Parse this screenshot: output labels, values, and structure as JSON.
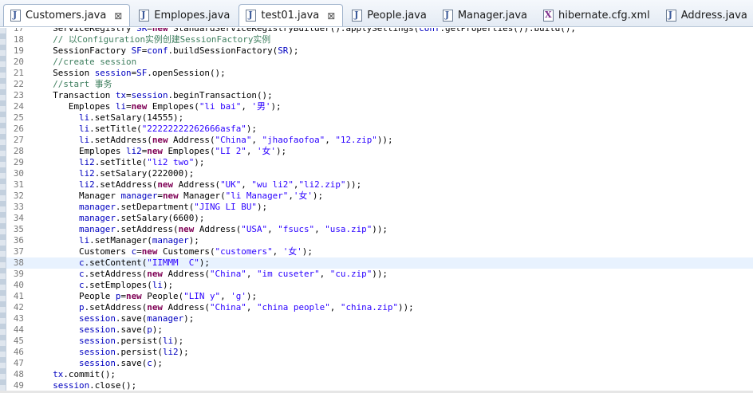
{
  "tabs": [
    {
      "label": "Customers.java",
      "icon": "java-file-icon",
      "close": "⊠",
      "state": "active"
    },
    {
      "label": "Emplopes.java",
      "icon": "java-file-icon",
      "close": "",
      "state": "normal"
    },
    {
      "label": "test01.java",
      "icon": "java-file-icon",
      "close": "⊠",
      "state": "selected"
    },
    {
      "label": "People.java",
      "icon": "java-file-icon",
      "close": "",
      "state": "normal"
    },
    {
      "label": "Manager.java",
      "icon": "java-file-icon",
      "close": "",
      "state": "normal"
    },
    {
      "label": "hibernate.cfg.xml",
      "icon": "xml-file-icon",
      "close": "",
      "state": "normal"
    },
    {
      "label": "Address.java",
      "icon": "java-file-icon",
      "close": "",
      "state": "normal"
    }
  ],
  "editor": {
    "current_line": "38",
    "lines": [
      {
        "n": "17",
        "indent": "    ",
        "tokens": [
          [
            "ServiceRegistry ",
            "p"
          ],
          [
            "SR",
            "v"
          ],
          [
            "=",
            "p"
          ],
          [
            "new",
            "k"
          ],
          [
            " StandardServiceRegistryBuilder().applySettings(",
            "p"
          ],
          [
            "conf",
            "v"
          ],
          [
            ".getProperties()).build();",
            "p"
          ]
        ]
      },
      {
        "n": "18",
        "indent": "    ",
        "tokens": [
          [
            "// 以Configuration实例创建SessionFactory实例",
            "c"
          ]
        ]
      },
      {
        "n": "19",
        "indent": "    ",
        "tokens": [
          [
            "SessionFactory ",
            "p"
          ],
          [
            "SF",
            "v"
          ],
          [
            "=",
            "p"
          ],
          [
            "conf",
            "v"
          ],
          [
            ".buildSessionFactory(",
            "p"
          ],
          [
            "SR",
            "v"
          ],
          [
            ");",
            "p"
          ]
        ]
      },
      {
        "n": "20",
        "indent": "    ",
        "tokens": [
          [
            "//create session",
            "c"
          ]
        ]
      },
      {
        "n": "21",
        "indent": "    ",
        "tokens": [
          [
            "Session ",
            "p"
          ],
          [
            "session",
            "v"
          ],
          [
            "=",
            "p"
          ],
          [
            "SF",
            "v"
          ],
          [
            ".openSession();",
            "p"
          ]
        ]
      },
      {
        "n": "22",
        "indent": "    ",
        "tokens": [
          [
            "//start 事务",
            "c"
          ]
        ]
      },
      {
        "n": "23",
        "indent": "    ",
        "tokens": [
          [
            "Transaction ",
            "p"
          ],
          [
            "tx",
            "v"
          ],
          [
            "=",
            "p"
          ],
          [
            "session",
            "v"
          ],
          [
            ".beginTransaction();",
            "p"
          ]
        ]
      },
      {
        "n": "24",
        "indent": "       ",
        "tokens": [
          [
            "Emplopes ",
            "p"
          ],
          [
            "li",
            "v"
          ],
          [
            "=",
            "p"
          ],
          [
            "new",
            "k"
          ],
          [
            " Emplopes(",
            "p"
          ],
          [
            "\"li bai\"",
            "s"
          ],
          [
            ", ",
            "p"
          ],
          [
            "'男'",
            "s"
          ],
          [
            ");",
            "p"
          ]
        ]
      },
      {
        "n": "25",
        "indent": "         ",
        "tokens": [
          [
            "li",
            "v"
          ],
          [
            ".setSalary(14555);",
            "p"
          ]
        ]
      },
      {
        "n": "26",
        "indent": "         ",
        "tokens": [
          [
            "li",
            "v"
          ],
          [
            ".setTitle(",
            "p"
          ],
          [
            "\"22222222262666asfa\"",
            "s"
          ],
          [
            ");",
            "p"
          ]
        ]
      },
      {
        "n": "27",
        "indent": "         ",
        "tokens": [
          [
            "li",
            "v"
          ],
          [
            ".setAddress(",
            "p"
          ],
          [
            "new",
            "k"
          ],
          [
            " Address(",
            "p"
          ],
          [
            "\"China\"",
            "s"
          ],
          [
            ", ",
            "p"
          ],
          [
            "\"jhaofaofoa\"",
            "s"
          ],
          [
            ", ",
            "p"
          ],
          [
            "\"12.zip\"",
            "s"
          ],
          [
            "));",
            "p"
          ]
        ]
      },
      {
        "n": "28",
        "indent": "         ",
        "tokens": [
          [
            "Emplopes ",
            "p"
          ],
          [
            "li2",
            "v"
          ],
          [
            "=",
            "p"
          ],
          [
            "new",
            "k"
          ],
          [
            " Emplopes(",
            "p"
          ],
          [
            "\"LI 2\"",
            "s"
          ],
          [
            ", ",
            "p"
          ],
          [
            "'女'",
            "s"
          ],
          [
            ");",
            "p"
          ]
        ]
      },
      {
        "n": "29",
        "indent": "         ",
        "tokens": [
          [
            "li2",
            "v"
          ],
          [
            ".setTitle(",
            "p"
          ],
          [
            "\"li2 two\"",
            "s"
          ],
          [
            ");",
            "p"
          ]
        ]
      },
      {
        "n": "30",
        "indent": "         ",
        "tokens": [
          [
            "li2",
            "v"
          ],
          [
            ".setSalary(222000);",
            "p"
          ]
        ]
      },
      {
        "n": "31",
        "indent": "         ",
        "tokens": [
          [
            "li2",
            "v"
          ],
          [
            ".setAddress(",
            "p"
          ],
          [
            "new",
            "k"
          ],
          [
            " Address(",
            "p"
          ],
          [
            "\"UK\"",
            "s"
          ],
          [
            ", ",
            "p"
          ],
          [
            "\"wu li2\"",
            "s"
          ],
          [
            ",",
            "p"
          ],
          [
            "\"li2.zip\"",
            "s"
          ],
          [
            "));",
            "p"
          ]
        ]
      },
      {
        "n": "32",
        "indent": "         ",
        "tokens": [
          [
            "Manager ",
            "p"
          ],
          [
            "manager",
            "v"
          ],
          [
            "=",
            "p"
          ],
          [
            "new",
            "k"
          ],
          [
            " Manager(",
            "p"
          ],
          [
            "\"li Manager\"",
            "s"
          ],
          [
            ",",
            "p"
          ],
          [
            "'女'",
            "s"
          ],
          [
            ");",
            "p"
          ]
        ]
      },
      {
        "n": "33",
        "indent": "         ",
        "tokens": [
          [
            "manager",
            "v"
          ],
          [
            ".setDepartment(",
            "p"
          ],
          [
            "\"JING LI BU\"",
            "s"
          ],
          [
            ");",
            "p"
          ]
        ]
      },
      {
        "n": "34",
        "indent": "         ",
        "tokens": [
          [
            "manager",
            "v"
          ],
          [
            ".setSalary(6600);",
            "p"
          ]
        ]
      },
      {
        "n": "35",
        "indent": "         ",
        "tokens": [
          [
            "manager",
            "v"
          ],
          [
            ".setAddress(",
            "p"
          ],
          [
            "new",
            "k"
          ],
          [
            " Address(",
            "p"
          ],
          [
            "\"USA\"",
            "s"
          ],
          [
            ", ",
            "p"
          ],
          [
            "\"fsucs\"",
            "s"
          ],
          [
            ", ",
            "p"
          ],
          [
            "\"usa.zip\"",
            "s"
          ],
          [
            "));",
            "p"
          ]
        ]
      },
      {
        "n": "36",
        "indent": "         ",
        "tokens": [
          [
            "li",
            "v"
          ],
          [
            ".setManager(",
            "p"
          ],
          [
            "manager",
            "v"
          ],
          [
            ");",
            "p"
          ]
        ]
      },
      {
        "n": "37",
        "indent": "         ",
        "tokens": [
          [
            "Customers ",
            "p"
          ],
          [
            "c",
            "v"
          ],
          [
            "=",
            "p"
          ],
          [
            "new",
            "k"
          ],
          [
            " Customers(",
            "p"
          ],
          [
            "\"customers\"",
            "s"
          ],
          [
            ", ",
            "p"
          ],
          [
            "'女'",
            "s"
          ],
          [
            ");",
            "p"
          ]
        ]
      },
      {
        "n": "38",
        "indent": "         ",
        "tokens": [
          [
            "c",
            "v"
          ],
          [
            ".setContent(",
            "p"
          ],
          [
            "\"IIMMM  C\"",
            "s"
          ],
          [
            ");",
            "p"
          ]
        ]
      },
      {
        "n": "39",
        "indent": "         ",
        "tokens": [
          [
            "c",
            "v"
          ],
          [
            ".setAddress(",
            "p"
          ],
          [
            "new",
            "k"
          ],
          [
            " Address(",
            "p"
          ],
          [
            "\"China\"",
            "s"
          ],
          [
            ", ",
            "p"
          ],
          [
            "\"im cuseter\"",
            "s"
          ],
          [
            ", ",
            "p"
          ],
          [
            "\"cu.zip\"",
            "s"
          ],
          [
            "));",
            "p"
          ]
        ]
      },
      {
        "n": "40",
        "indent": "         ",
        "tokens": [
          [
            "c",
            "v"
          ],
          [
            ".setEmplopes(",
            "p"
          ],
          [
            "li",
            "v"
          ],
          [
            ");",
            "p"
          ]
        ]
      },
      {
        "n": "41",
        "indent": "         ",
        "tokens": [
          [
            "People ",
            "p"
          ],
          [
            "p",
            "v"
          ],
          [
            "=",
            "p"
          ],
          [
            "new",
            "k"
          ],
          [
            " People(",
            "p"
          ],
          [
            "\"LIN y\"",
            "s"
          ],
          [
            ", ",
            "p"
          ],
          [
            "'g'",
            "s"
          ],
          [
            ");",
            "p"
          ]
        ]
      },
      {
        "n": "42",
        "indent": "         ",
        "tokens": [
          [
            "p",
            "v"
          ],
          [
            ".setAddress(",
            "p"
          ],
          [
            "new",
            "k"
          ],
          [
            " Address(",
            "p"
          ],
          [
            "\"China\"",
            "s"
          ],
          [
            ", ",
            "p"
          ],
          [
            "\"china people\"",
            "s"
          ],
          [
            ", ",
            "p"
          ],
          [
            "\"china.zip\"",
            "s"
          ],
          [
            "));",
            "p"
          ]
        ]
      },
      {
        "n": "43",
        "indent": "         ",
        "tokens": [
          [
            "session",
            "v"
          ],
          [
            ".save(",
            "p"
          ],
          [
            "manager",
            "v"
          ],
          [
            ");",
            "p"
          ]
        ]
      },
      {
        "n": "44",
        "indent": "         ",
        "tokens": [
          [
            "session",
            "v"
          ],
          [
            ".save(",
            "p"
          ],
          [
            "p",
            "v"
          ],
          [
            ");",
            "p"
          ]
        ]
      },
      {
        "n": "45",
        "indent": "         ",
        "tokens": [
          [
            "session",
            "v"
          ],
          [
            ".persist(",
            "p"
          ],
          [
            "li",
            "v"
          ],
          [
            ");",
            "p"
          ]
        ]
      },
      {
        "n": "46",
        "indent": "         ",
        "tokens": [
          [
            "session",
            "v"
          ],
          [
            ".persist(",
            "p"
          ],
          [
            "li2",
            "v"
          ],
          [
            ");",
            "p"
          ]
        ]
      },
      {
        "n": "47",
        "indent": "         ",
        "tokens": [
          [
            "session",
            "v"
          ],
          [
            ".save(",
            "p"
          ],
          [
            "c",
            "v"
          ],
          [
            ");",
            "p"
          ]
        ]
      },
      {
        "n": "48",
        "indent": "    ",
        "tokens": [
          [
            "tx",
            "v"
          ],
          [
            ".commit();",
            "p"
          ]
        ]
      },
      {
        "n": "49",
        "indent": "    ",
        "tokens": [
          [
            "session",
            "v"
          ],
          [
            ".close();",
            "p"
          ]
        ]
      }
    ]
  },
  "colors": {
    "keyword": "#7f0055",
    "string": "#2a00ff",
    "comment": "#3f7f5f",
    "field": "#0000c0",
    "current_line_bg": "#e8f2fe"
  }
}
